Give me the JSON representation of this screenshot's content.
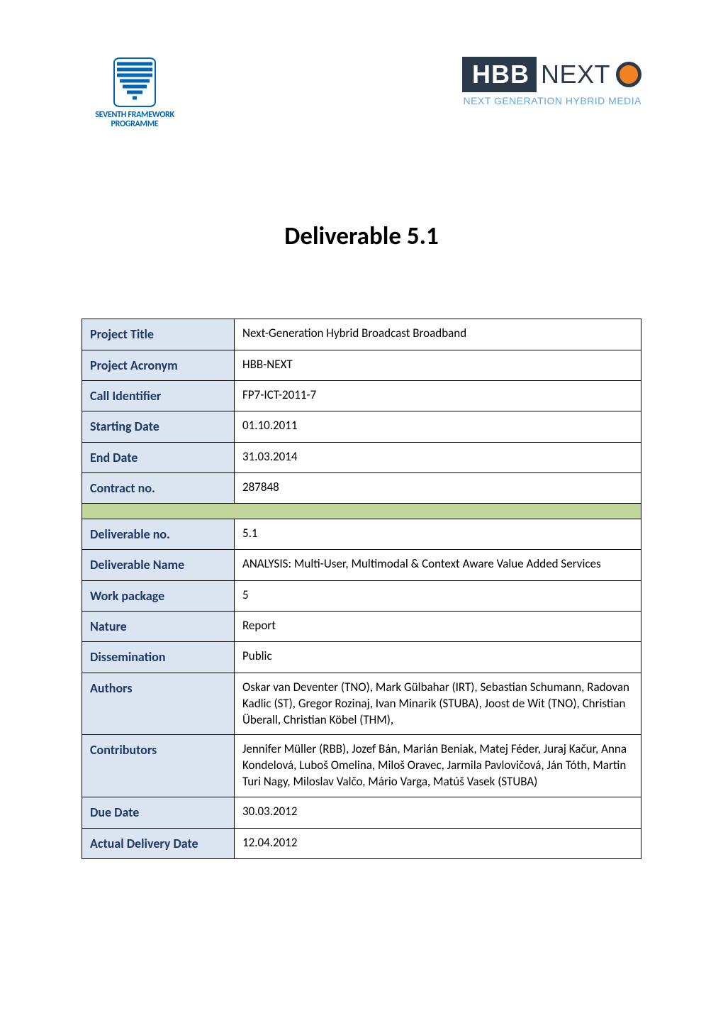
{
  "logos": {
    "fp7": {
      "line1": "SEVENTH FRAMEWORK",
      "line2": "PROGRAMME"
    },
    "hbb": {
      "dark": "HBB",
      "light": "NEXT",
      "tag": "NEXT GENERATION HYBRID MEDIA"
    }
  },
  "title": "Deliverable 5.1",
  "meta": {
    "project_title": {
      "label": "Project Title",
      "value": "Next-Generation Hybrid Broadcast Broadband"
    },
    "project_acronym": {
      "label": "Project Acronym",
      "value": "HBB-NEXT"
    },
    "call_identifier": {
      "label": "Call Identifier",
      "value": "FP7-ICT-2011-7"
    },
    "starting_date": {
      "label": "Starting Date",
      "value": "01.10.2011"
    },
    "end_date": {
      "label": "End Date",
      "value": "31.03.2014"
    },
    "contract_no": {
      "label": "Contract no.",
      "value": "287848"
    },
    "deliverable_no": {
      "label": "Deliverable no.",
      "value": "5.1"
    },
    "deliverable_name": {
      "label": "Deliverable Name",
      "value": "ANALYSIS: Multi-User, Multimodal & Context Aware Value Added Services"
    },
    "work_package": {
      "label": "Work package",
      "value": "5"
    },
    "nature": {
      "label": "Nature",
      "value": "Report"
    },
    "dissemination": {
      "label": "Dissemination",
      "value": "Public"
    },
    "authors": {
      "label": "Authors",
      "value": "Oskar van Deventer (TNO), Mark Gülbahar (IRT), Sebastian Schumann, Radovan Kadlic (ST), Gregor Rozinaj, Ivan Minarik (STUBA), Joost de Wit (TNO), Christian Überall, Christian Köbel (THM),"
    },
    "contributors": {
      "label": "Contributors",
      "value": "Jennifer Müller (RBB), Jozef Bán, Marián Beniak, Matej Féder, Juraj Kačur, Anna Kondelová, Luboš Omelina, Miloš Oravec, Jarmila Pavlovičová, Ján Tóth, Martin Turi Nagy, Miloslav Valčo, Mário Varga, Matúš Vasek (STUBA)"
    },
    "due_date": {
      "label": "Due Date",
      "value": "30.03.2012"
    },
    "actual_delivery_date": {
      "label": "Actual Delivery Date",
      "value": "12.04.2012"
    }
  }
}
